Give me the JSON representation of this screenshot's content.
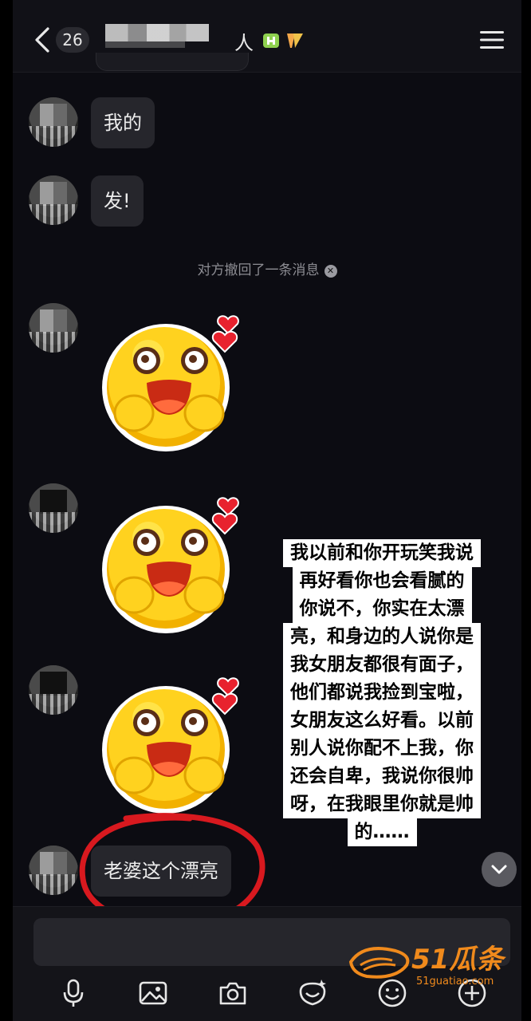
{
  "header": {
    "back_icon": "chevron-left-icon",
    "unread_count": "26",
    "title_tail": "人",
    "menu_icon": "hamburger-menu-icon"
  },
  "messages": [
    {
      "type": "text",
      "text": "我的"
    },
    {
      "type": "text",
      "text": "发!"
    },
    {
      "type": "system",
      "text": "对方撤回了一条消息"
    },
    {
      "type": "sticker",
      "name": "smiley-hug-sticker"
    },
    {
      "type": "sticker",
      "name": "smiley-hug-sticker"
    },
    {
      "type": "sticker",
      "name": "smiley-hug-sticker"
    },
    {
      "type": "text",
      "text": "老婆这个漂亮"
    }
  ],
  "overlay_caption": {
    "lines": [
      "我以前和你开玩笑我说",
      "再好看你也会看腻的",
      "你说不，你实在太漂",
      "亮，和身边的人说你是",
      "我女朋友都很有面子，",
      "他们都说我捡到宝啦，",
      "女朋友这么好看。以前",
      "别人说你配不上我，你",
      "还会自卑，我说你很帅",
      "呀，在我眼里你就是帅",
      "的……"
    ]
  },
  "toolbar": {
    "icons": [
      "microphone-icon",
      "image-icon",
      "camera-icon",
      "sticker-icon",
      "emoji-icon",
      "plus-icon"
    ]
  },
  "watermark": {
    "main": "51瓜条",
    "sub": "51guatiao.com"
  },
  "colors": {
    "background": "#0c0c12",
    "bubble": "#26262c",
    "annotation_red": "#d8191f",
    "watermark_orange": "#f08a1c"
  }
}
